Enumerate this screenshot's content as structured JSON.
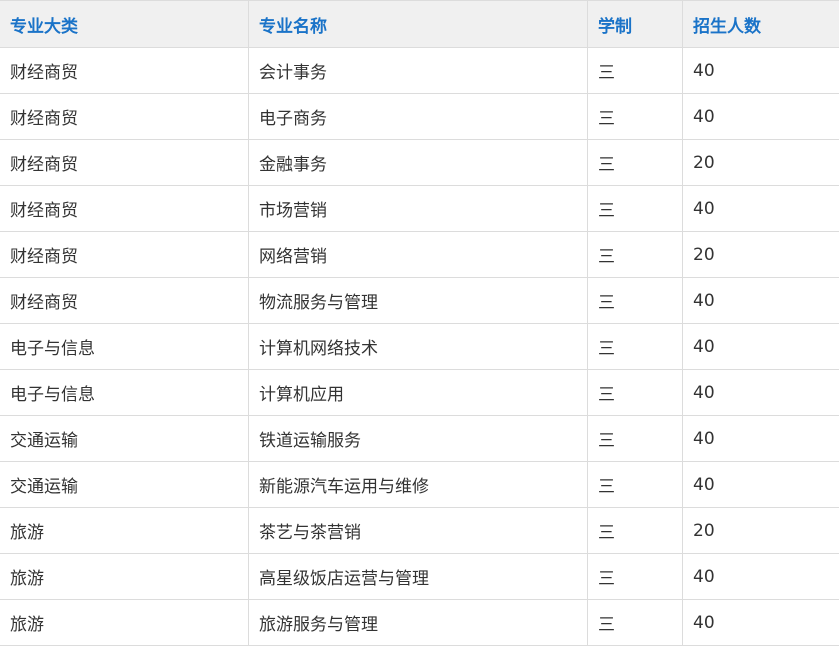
{
  "table": {
    "headers": [
      "专业大类",
      "专业名称",
      "学制",
      "招生人数"
    ],
    "rows": [
      {
        "category": "财经商贸",
        "major": "会计事务",
        "duration": "三",
        "enrollment": "40"
      },
      {
        "category": "财经商贸",
        "major": "电子商务",
        "duration": "三",
        "enrollment": "40"
      },
      {
        "category": "财经商贸",
        "major": "金融事务",
        "duration": "三",
        "enrollment": "20"
      },
      {
        "category": "财经商贸",
        "major": "市场营销",
        "duration": "三",
        "enrollment": "40"
      },
      {
        "category": "财经商贸",
        "major": "网络营销",
        "duration": "三",
        "enrollment": "20"
      },
      {
        "category": "财经商贸",
        "major": "物流服务与管理",
        "duration": "三",
        "enrollment": "40"
      },
      {
        "category": "电子与信息",
        "major": "计算机网络技术",
        "duration": "三",
        "enrollment": "40"
      },
      {
        "category": "电子与信息",
        "major": "计算机应用",
        "duration": "三",
        "enrollment": "40"
      },
      {
        "category": "交通运输",
        "major": "铁道运输服务",
        "duration": "三",
        "enrollment": "40"
      },
      {
        "category": "交通运输",
        "major": "新能源汽车运用与维修",
        "duration": "三",
        "enrollment": "40"
      },
      {
        "category": "旅游",
        "major": "茶艺与茶营销",
        "duration": "三",
        "enrollment": "20"
      },
      {
        "category": "旅游",
        "major": "高星级饭店运营与管理",
        "duration": "三",
        "enrollment": "40"
      },
      {
        "category": "旅游",
        "major": "旅游服务与管理",
        "duration": "三",
        "enrollment": "40"
      }
    ]
  }
}
